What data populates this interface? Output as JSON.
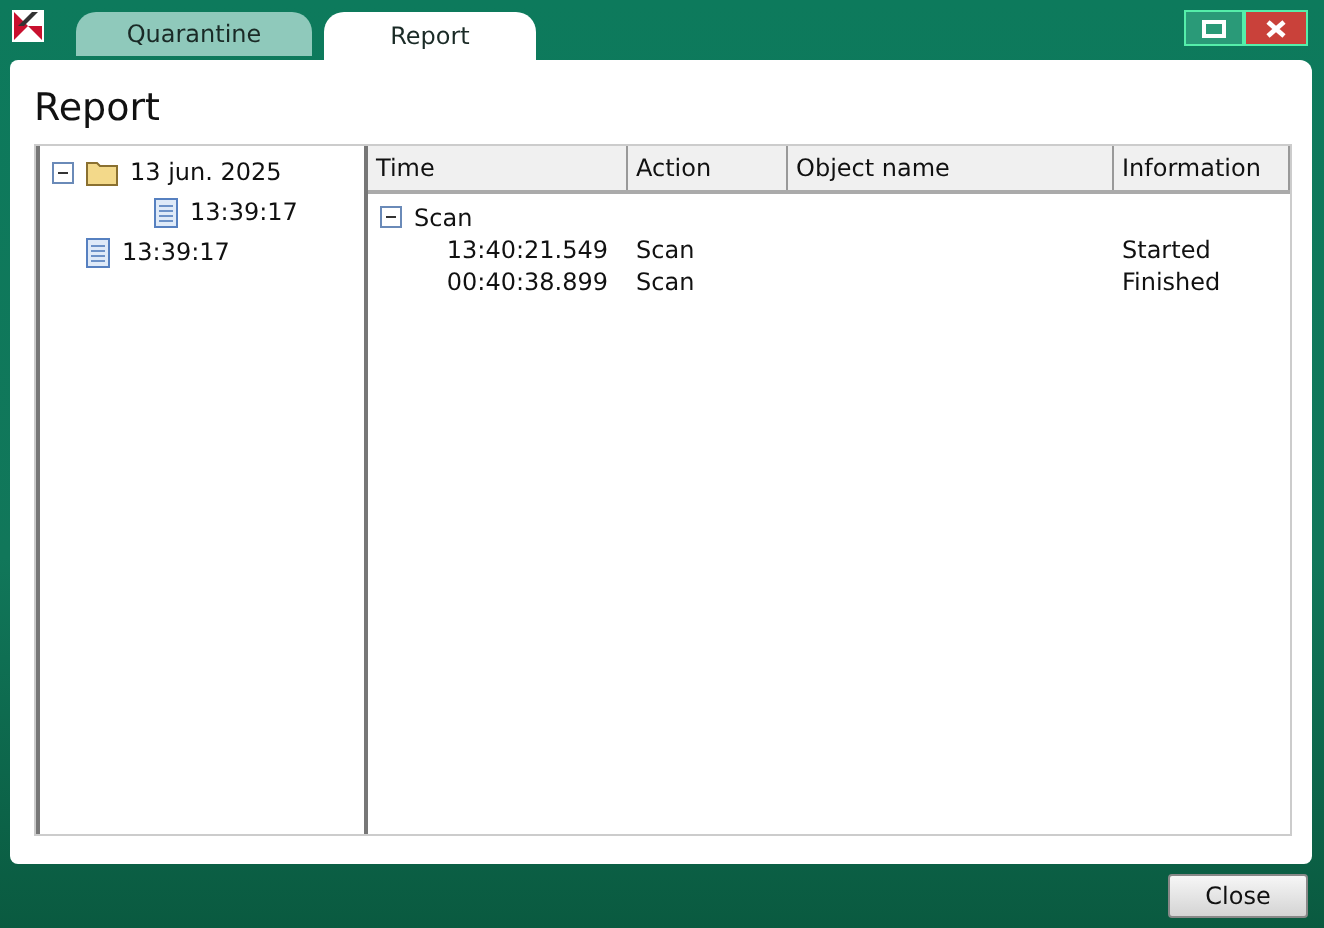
{
  "tabs": [
    {
      "label": "Quarantine",
      "selected": false
    },
    {
      "label": "Report",
      "selected": true
    }
  ],
  "page_title": "Report",
  "tree": [
    {
      "label": "13 jun. 2025",
      "kind": "folder",
      "expanded": true,
      "children": [
        {
          "label": "13:39:17",
          "kind": "file"
        }
      ]
    },
    {
      "label": "13:39:17",
      "kind": "file"
    }
  ],
  "table": {
    "columns": [
      "Time",
      "Action",
      "Object name",
      "Information"
    ],
    "groups": [
      {
        "label": "Scan",
        "expanded": true,
        "rows": [
          {
            "time": "13:40:21.549",
            "action": "Scan",
            "information": "Started"
          },
          {
            "time": "00:40:38.899",
            "action": "Scan",
            "information": "Finished"
          }
        ]
      }
    ]
  },
  "buttons": [
    "Close"
  ]
}
